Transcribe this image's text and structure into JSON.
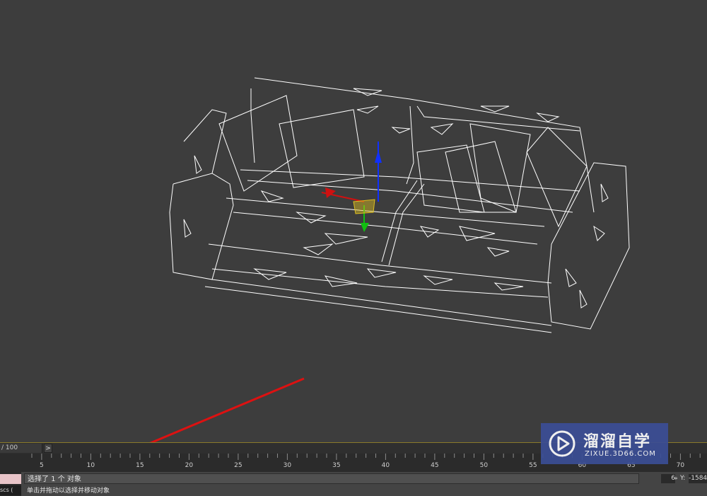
{
  "viewport": {
    "label": "Perspective wireframe viewport with selected sofa model and move gizmo",
    "background": "#3d3d3d",
    "wire_color": "#ffffff",
    "gizmo_colors": {
      "x": "#d01010",
      "y": "#10c010",
      "z": "#1030ff",
      "plane": "#e0c020"
    },
    "annotation_arrow_color": "#dd1111"
  },
  "timeline": {
    "frame_counter": "/ 100",
    "next_frame": ">",
    "tick_labels": [
      "5",
      "10",
      "15",
      "20",
      "25",
      "30",
      "35",
      "40",
      "45",
      "50",
      "55",
      "60",
      "65",
      "70"
    ]
  },
  "status": {
    "maxscript_text": "scs (",
    "selection_text": "选择了 1 个 对象",
    "prompt_text": "单击并拖动以选择并移动对象",
    "coord_x_value": "6",
    "coord_spinner": "≑",
    "coord_y_label": "Y:",
    "coord_y_value": "-1584"
  },
  "watermark": {
    "title": "溜溜自学",
    "url": "ZIXUE.3D66.COM",
    "bg_color": "#3b4e96"
  }
}
